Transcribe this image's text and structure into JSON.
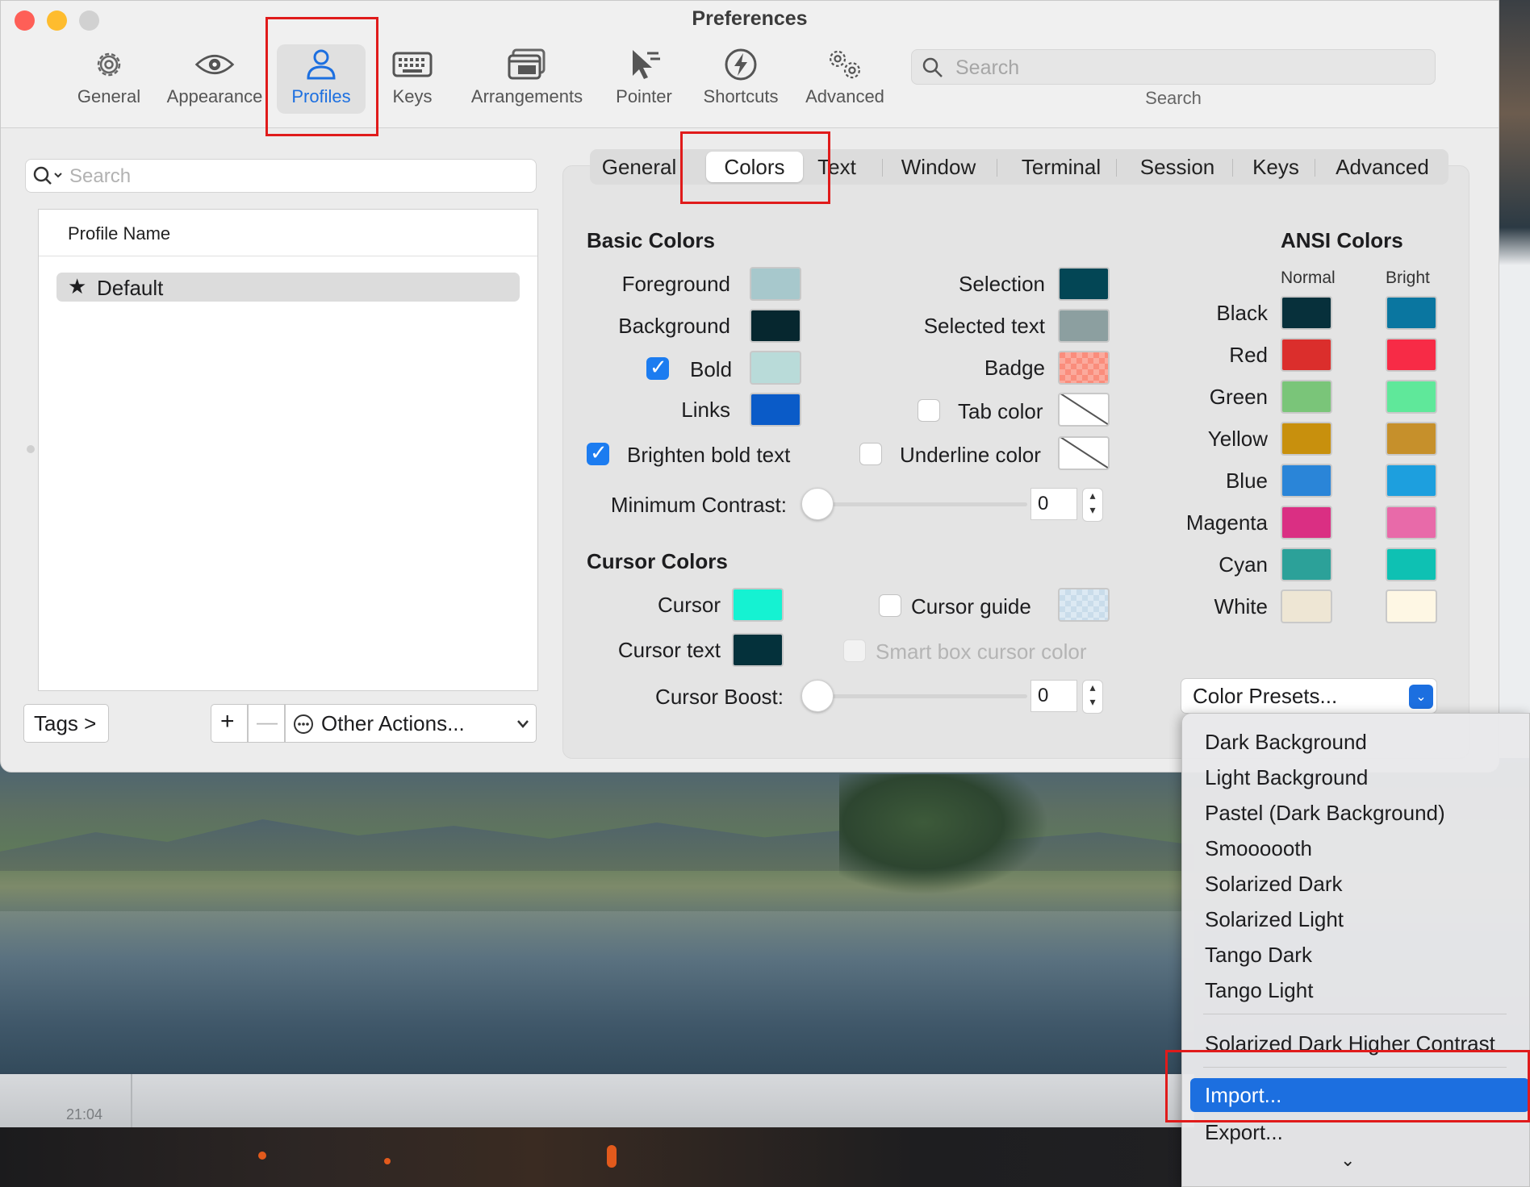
{
  "window": {
    "title": "Preferences"
  },
  "toolbar": {
    "items": [
      {
        "label": "General",
        "icon": "gear-icon"
      },
      {
        "label": "Appearance",
        "icon": "eye-icon"
      },
      {
        "label": "Profiles",
        "icon": "person-icon",
        "active": true
      },
      {
        "label": "Keys",
        "icon": "keyboard-icon"
      },
      {
        "label": "Arrangements",
        "icon": "window-stack-icon"
      },
      {
        "label": "Pointer",
        "icon": "cursor-icon"
      },
      {
        "label": "Shortcuts",
        "icon": "lightning-icon"
      },
      {
        "label": "Advanced",
        "icon": "gears-icon"
      }
    ],
    "search_placeholder": "Search",
    "search_caption": "Search"
  },
  "profiles": {
    "search_placeholder": "Search",
    "column_header": "Profile Name",
    "rows": [
      {
        "name": "Default",
        "default": true
      }
    ],
    "tags_button": "Tags >",
    "add_button": "+",
    "remove_button": "—",
    "other_actions": "Other Actions..."
  },
  "tabs": [
    "General",
    "Colors",
    "Text",
    "Window",
    "Terminal",
    "Session",
    "Keys",
    "Advanced"
  ],
  "active_tab": "Colors",
  "basic_colors": {
    "heading": "Basic Colors",
    "foreground": {
      "label": "Foreground",
      "color": "#a7c8cc"
    },
    "background": {
      "label": "Background",
      "color": "#06272f"
    },
    "bold": {
      "label": "Bold",
      "color": "#b9dbd9",
      "checked": true
    },
    "links": {
      "label": "Links",
      "color": "#0a5bc8"
    },
    "selection": {
      "label": "Selection",
      "color": "#034655"
    },
    "selected_text": {
      "label": "Selected text",
      "color": "#8c9fa0"
    },
    "badge": {
      "label": "Badge",
      "color": "#fa8d7c"
    },
    "tab_color": {
      "label": "Tab color",
      "checked": false
    },
    "brighten_bold": {
      "label": "Brighten bold text",
      "checked": true
    },
    "underline_color": {
      "label": "Underline color",
      "checked": false
    },
    "min_contrast": {
      "label": "Minimum Contrast:",
      "value": "0"
    }
  },
  "cursor_colors": {
    "heading": "Cursor Colors",
    "cursor": {
      "label": "Cursor",
      "color": "#15f2d2"
    },
    "cursor_text": {
      "label": "Cursor text",
      "color": "#04313b"
    },
    "cursor_guide": {
      "label": "Cursor guide",
      "checked": false,
      "color": "#dce9f3"
    },
    "smart_box": {
      "label": "Smart box cursor color",
      "disabled": true
    },
    "cursor_boost": {
      "label": "Cursor Boost:",
      "value": "0"
    }
  },
  "ansi": {
    "heading": "ANSI Colors",
    "normal_header": "Normal",
    "bright_header": "Bright",
    "rows": [
      {
        "name": "Black",
        "normal": "#07303b",
        "bright": "#0a76a0"
      },
      {
        "name": "Red",
        "normal": "#db2e2c",
        "bright": "#f72b46"
      },
      {
        "name": "Green",
        "normal": "#7ac579",
        "bright": "#5fe89a"
      },
      {
        "name": "Yellow",
        "normal": "#c8900d",
        "bright": "#c6902b"
      },
      {
        "name": "Blue",
        "normal": "#2a85d8",
        "bright": "#1d9fde"
      },
      {
        "name": "Magenta",
        "normal": "#da2f83",
        "bright": "#e86aa9"
      },
      {
        "name": "Cyan",
        "normal": "#2ca199",
        "bright": "#0ec1b3"
      },
      {
        "name": "White",
        "normal": "#eee6d4",
        "bright": "#fef7e4"
      }
    ]
  },
  "presets": {
    "label": "Color Presets...",
    "menu": [
      "Dark Background",
      "Light Background",
      "Pastel (Dark Background)",
      "Smoooooth",
      "Solarized Dark",
      "Solarized Light",
      "Tango Dark",
      "Tango Light",
      "Solarized Dark Higher Contrast",
      "Import...",
      "Export..."
    ],
    "highlighted": "Import..."
  },
  "dock": {
    "time": "21:04"
  }
}
